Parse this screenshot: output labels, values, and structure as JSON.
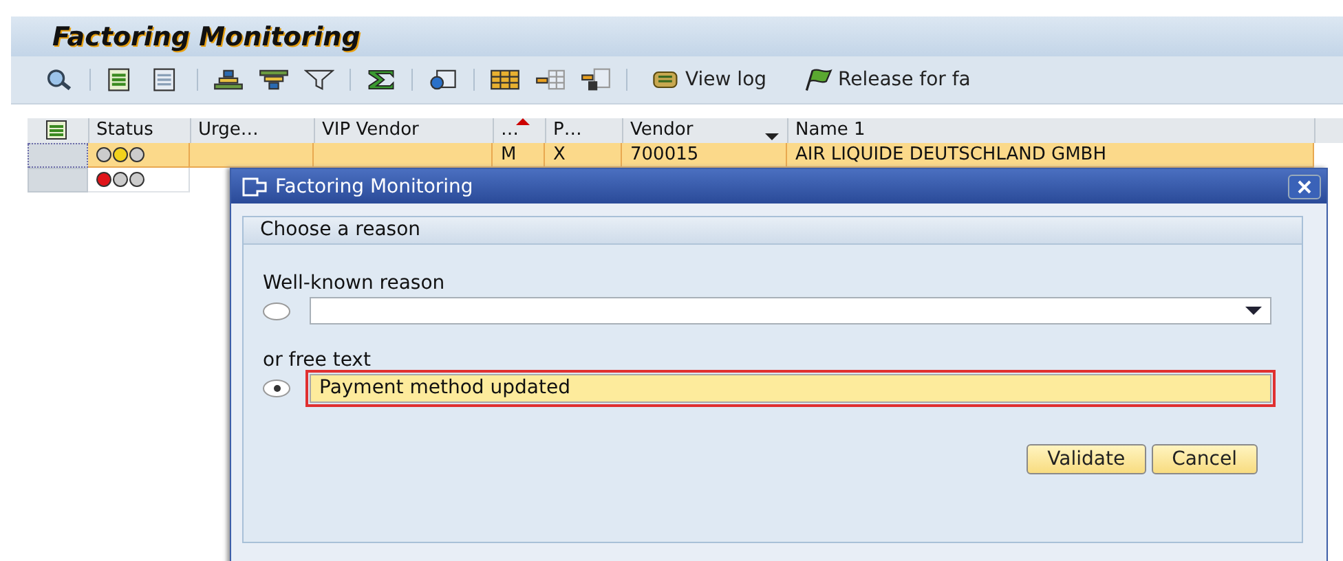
{
  "window": {
    "title": "Factoring Monitoring"
  },
  "toolbar": {
    "buttons": [
      {
        "label": "View log"
      },
      {
        "label": "Release for fa"
      }
    ]
  },
  "table": {
    "columns": [
      "Status",
      "Urge…",
      "VIP Vendor",
      "…",
      "P…",
      "Vendor",
      "Name 1"
    ],
    "rows": [
      {
        "selected": true,
        "lights": [
          {
            "color": "#cccccc"
          },
          {
            "color": "#f2d21c"
          },
          {
            "color": "#cccccc"
          }
        ],
        "cells": [
          "",
          "",
          "",
          "M",
          "X",
          "700015",
          "AIR LIQUIDE DEUTSCHLAND GMBH"
        ]
      },
      {
        "selected": false,
        "lights": [
          {
            "color": "#e0141a"
          },
          {
            "color": "#cccccc"
          },
          {
            "color": "#cccccc"
          }
        ],
        "cells": [
          ""
        ]
      }
    ]
  },
  "dialog": {
    "title": "Factoring Monitoring",
    "group_title": "Choose a reason",
    "options": [
      {
        "kind": "dropdown",
        "label": "Well-known reason",
        "selected": false
      },
      {
        "kind": "text",
        "label": "or free text",
        "selected": true,
        "value": "Payment method updated"
      }
    ],
    "buttons": [
      "Validate",
      "Cancel"
    ]
  }
}
